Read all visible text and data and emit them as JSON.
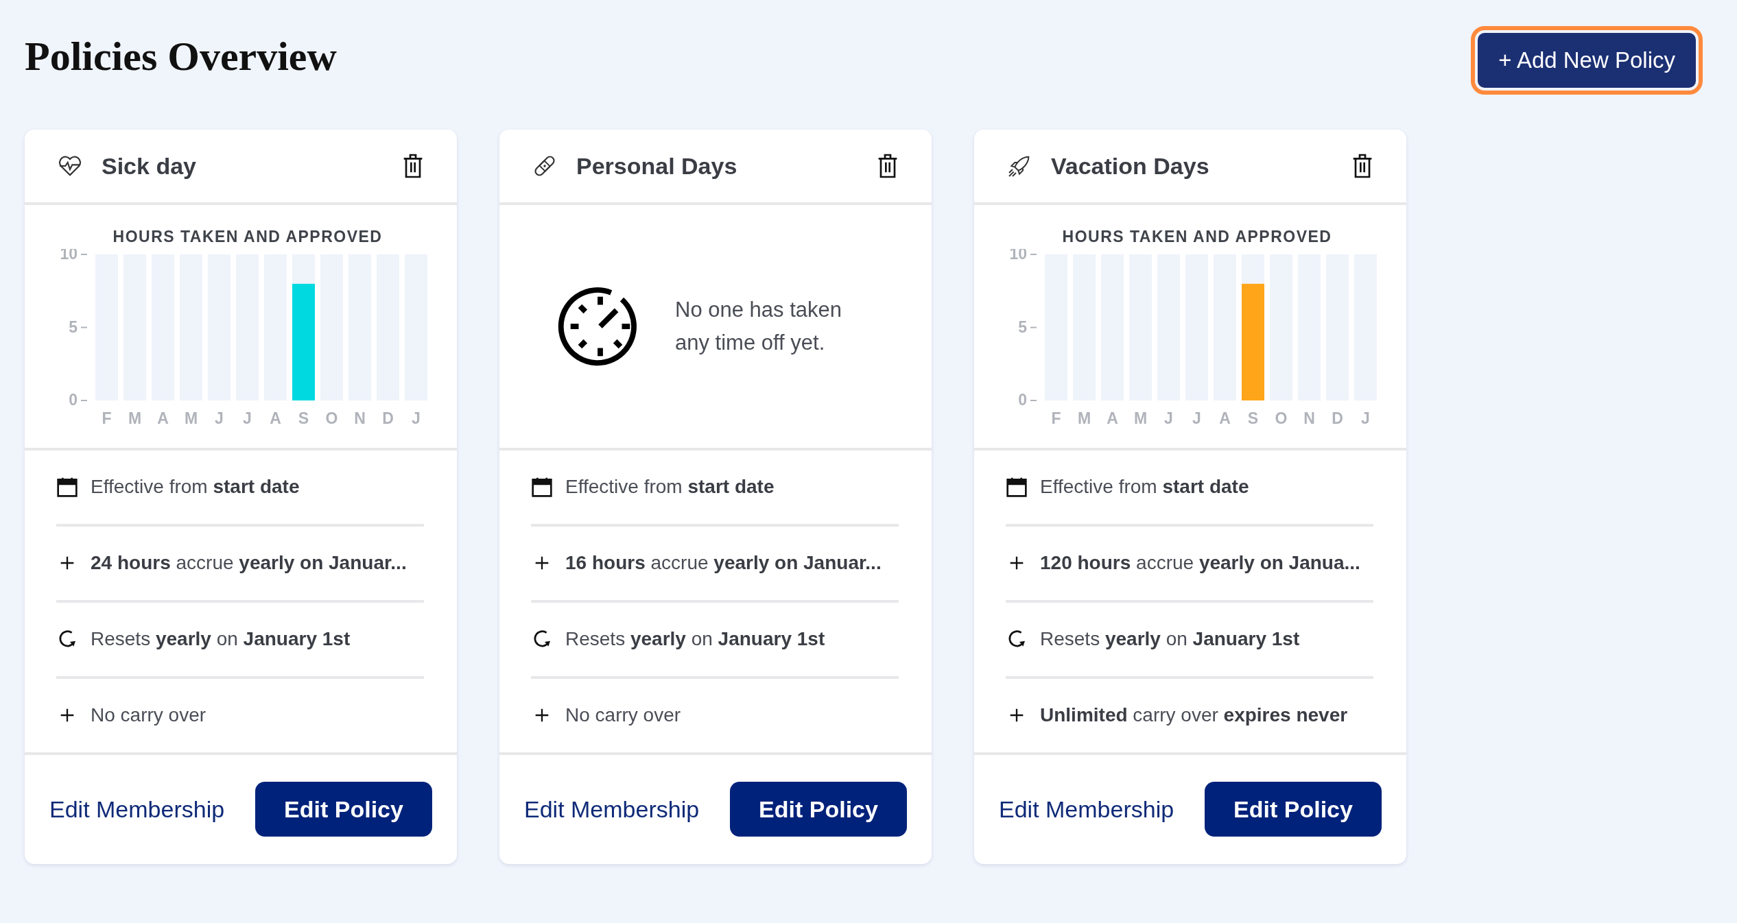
{
  "page": {
    "title": "Policies Overview"
  },
  "add_button": {
    "label": "+ Add New Policy",
    "focused": true
  },
  "policies": [
    {
      "title": "Sick day",
      "chart_data": {
        "type": "bar",
        "title": "HOURS TAKEN AND APPROVED",
        "categories": [
          "F",
          "M",
          "A",
          "M",
          "J",
          "J",
          "A",
          "S",
          "O",
          "N",
          "D",
          "J"
        ],
        "series": [
          {
            "color": "#00d9e0",
            "values": [
              0,
              0,
              0,
              0,
              0,
              0,
              0,
              8,
              0,
              0,
              0,
              0
            ]
          },
          {
            "color": "#eff3fa",
            "values": [
              10,
              10,
              10,
              10,
              10,
              10,
              10,
              2,
              10,
              10,
              10,
              10
            ]
          }
        ],
        "stacked": true,
        "ylim": [
          0,
          10
        ],
        "yticks": [
          0,
          5,
          10
        ]
      },
      "details": [
        {
          "kind": "calendar",
          "text": "Effective from **start date**"
        },
        {
          "kind": "plus",
          "text": "**24 hours** accrue **yearly on Januar...**"
        },
        {
          "kind": "reset",
          "text": "Resets **yearly** on **January 1st**"
        },
        {
          "kind": "plus",
          "text": "No carry over"
        }
      ],
      "link": "Edit Membership",
      "button": "Edit Policy"
    },
    {
      "title": "Personal Days",
      "empty_message": "No one has taken any time off yet.",
      "details": [
        {
          "kind": "calendar",
          "text": "Effective from **start date**"
        },
        {
          "kind": "plus",
          "text": "**16 hours** accrue **yearly on Januar...**"
        },
        {
          "kind": "reset",
          "text": "Resets **yearly** on **January 1st**"
        },
        {
          "kind": "plus",
          "text": "No carry over"
        }
      ],
      "link": "Edit Membership",
      "button": "Edit Policy"
    },
    {
      "title": "Vacation Days",
      "chart_data": {
        "type": "bar",
        "title": "HOURS TAKEN AND APPROVED",
        "categories": [
          "F",
          "M",
          "A",
          "M",
          "J",
          "J",
          "A",
          "S",
          "O",
          "N",
          "D",
          "J"
        ],
        "series": [
          {
            "color": "#ffa51a",
            "values": [
              0,
              0,
              0,
              0,
              0,
              0,
              0,
              8,
              0,
              0,
              0,
              0
            ]
          },
          {
            "color": "#eff3fa",
            "values": [
              10,
              10,
              10,
              10,
              10,
              10,
              10,
              2,
              10,
              10,
              10,
              10
            ]
          }
        ],
        "stacked": true,
        "ylim": [
          0,
          10
        ],
        "yticks": [
          0,
          5,
          10
        ]
      },
      "details": [
        {
          "kind": "calendar",
          "text": "Effective from **start date**"
        },
        {
          "kind": "plus",
          "text": "**120 hours** accrue **yearly on Janua...**"
        },
        {
          "kind": "reset",
          "text": "Resets **yearly** on **January 1st**"
        },
        {
          "kind": "plus",
          "text": "**Unlimited** carry over **expires never**"
        }
      ],
      "link": "Edit Membership",
      "button": "Edit Policy"
    }
  ]
}
